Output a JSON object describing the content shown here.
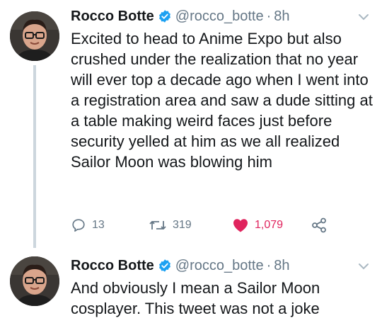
{
  "tweets": [
    {
      "name": "Rocco Botte",
      "handle": "@rocco_botte",
      "separator": "·",
      "time": "8h",
      "text": "Excited to head to Anime Expo but also crushed under the realization that no year will ever top a decade ago when I went into a registration area and saw a dude sitting at a table making weird faces just before security yelled at him as we all realized Sailor Moon was blowing him",
      "actions": {
        "replies": "13",
        "retweets": "319",
        "likes": "1,079"
      }
    },
    {
      "name": "Rocco Botte",
      "handle": "@rocco_botte",
      "separator": "·",
      "time": "8h",
      "text": "And obviously I mean a Sailor Moon cosplayer. This tweet was not a joke"
    }
  ],
  "colors": {
    "verified": "#1da1f2",
    "like": "#e0245e",
    "muted": "#657786",
    "thread_line": "#ccd6dd"
  },
  "icons": [
    "verified-badge-icon",
    "chevron-down-icon",
    "reply-icon",
    "retweet-icon",
    "heart-icon",
    "share-icon"
  ]
}
